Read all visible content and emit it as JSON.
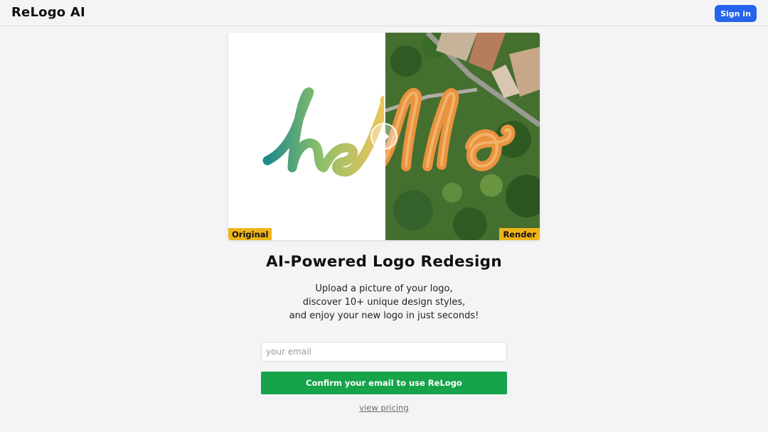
{
  "header": {
    "brand": "ReLogo AI",
    "signin_label": "Sign in"
  },
  "comparison": {
    "left_word": "hello",
    "right_word": "hello",
    "original_label": "Original",
    "render_label": "Render",
    "colors": {
      "gradient_start": "#1f8a8a",
      "gradient_mid": "#8cc06a",
      "gradient_end": "#f2c45a",
      "render_letters": "#e9933f",
      "aerial_green": "#3f6b2c"
    }
  },
  "hero": {
    "title": "AI-Powered Logo Redesign",
    "lines": [
      "Upload a picture of your logo,",
      "discover 10+ unique design styles,",
      "and enjoy your new logo in just seconds!"
    ]
  },
  "form": {
    "email_placeholder": "your email",
    "email_value": "",
    "confirm_label": "Confirm your email to use ReLogo",
    "pricing_link": "view pricing"
  },
  "colors": {
    "primary_blue": "#2563eb",
    "confirm_green": "#16a34a",
    "tag_yellow": "#f0b418"
  }
}
